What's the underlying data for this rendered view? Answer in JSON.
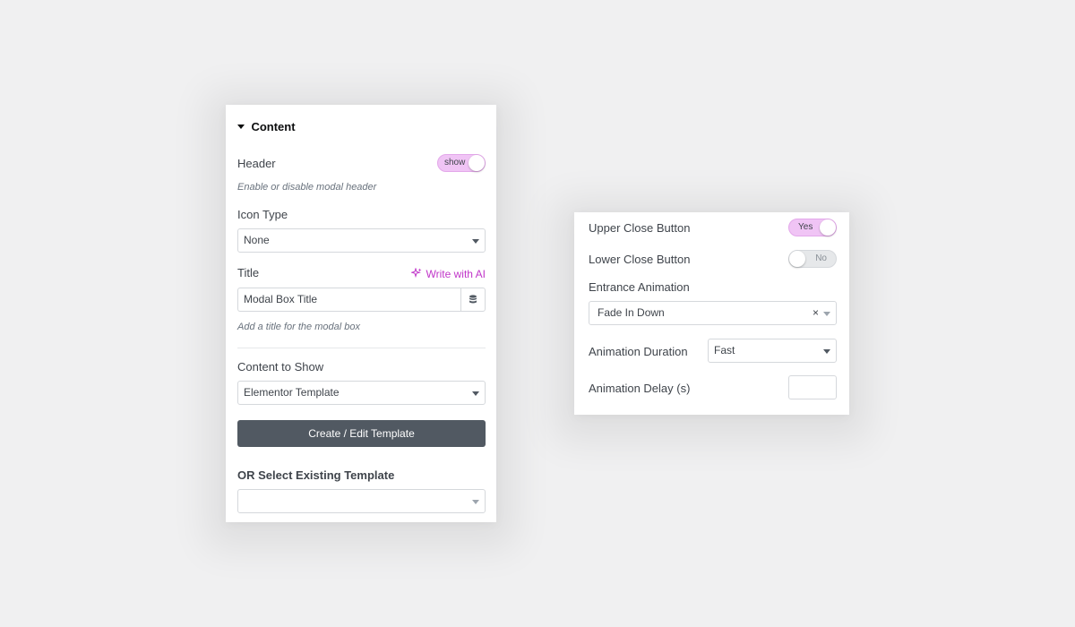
{
  "content_panel": {
    "section_title": "Content",
    "header": {
      "label": "Header",
      "toggle_text": "show",
      "hint": "Enable or disable modal header"
    },
    "icon_type": {
      "label": "Icon Type",
      "value": "None"
    },
    "title": {
      "label": "Title",
      "ai_link": "Write with AI",
      "value": "Modal Box Title",
      "hint": "Add a title for the modal box"
    },
    "content_to_show": {
      "label": "Content to Show",
      "value": "Elementor Template"
    },
    "create_button": "Create / Edit Template",
    "existing_template": {
      "label": "OR Select Existing Template",
      "value": ""
    }
  },
  "close_panel": {
    "upper_close": {
      "label": "Upper Close Button",
      "toggle_text": "Yes",
      "state": "on"
    },
    "lower_close": {
      "label": "Lower Close Button",
      "toggle_text": "No",
      "state": "off"
    },
    "entrance_animation": {
      "label": "Entrance Animation",
      "value": "Fade In Down",
      "clear": "×"
    },
    "animation_duration": {
      "label": "Animation Duration",
      "value": "Fast"
    },
    "animation_delay": {
      "label": "Animation Delay (s)",
      "value": ""
    }
  },
  "colors": {
    "toggle_on": "#f0c4f5",
    "ai_accent": "#c036c9",
    "button_dark": "#515962"
  }
}
